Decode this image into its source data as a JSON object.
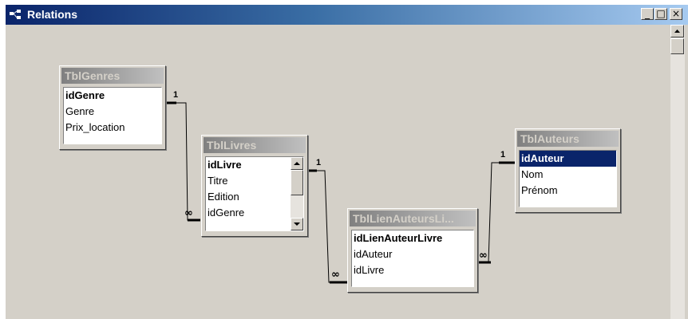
{
  "window": {
    "title": "Relations",
    "minimize_label": "_",
    "maximize_label": "□",
    "close_label": "×"
  },
  "tables": [
    {
      "title": "TblGenres",
      "fields": [
        "idGenre",
        "Genre",
        "Prix_location"
      ],
      "key": "idGenre"
    },
    {
      "title": "TblLivres",
      "fields": [
        "idLivre",
        "Titre",
        "Edition",
        "idGenre"
      ],
      "key": "idLivre"
    },
    {
      "title": "TblLienAuteursLi...",
      "fields": [
        "idLienAuteurLivre",
        "idAuteur",
        "idLivre"
      ],
      "key": "idLienAuteurLivre"
    },
    {
      "title": "TblAuteurs",
      "fields": [
        "idAuteur",
        "Nom",
        "Prénom"
      ],
      "key": "idAuteur",
      "selected": "idAuteur"
    }
  ],
  "relationships": [
    {
      "from": "TblGenres.idGenre",
      "to": "TblLivres.idGenre",
      "one_label": "1",
      "many_label": "∞"
    },
    {
      "from": "TblLivres.idLivre",
      "to": "TblLienAuteursLivres.idLivre",
      "one_label": "1",
      "many_label": "∞"
    },
    {
      "from": "TblAuteurs.idAuteur",
      "to": "TblLienAuteursLivres.idAuteur",
      "one_label": "1",
      "many_label": "∞"
    }
  ],
  "icons": {
    "window": "relations-icon",
    "scroll_up": "arrow-up-icon",
    "scroll_down": "arrow-down-icon"
  }
}
